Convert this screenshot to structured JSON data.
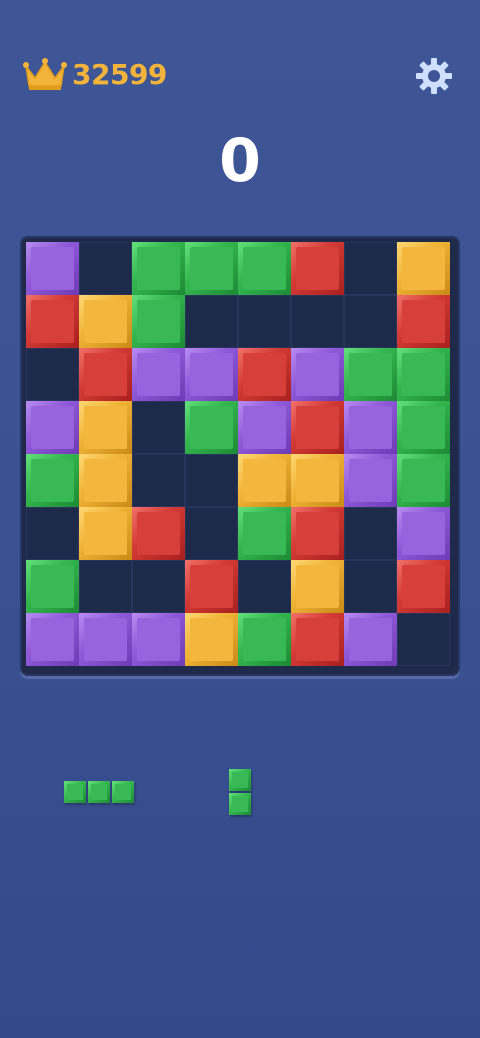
{
  "header": {
    "best_score": "32599",
    "current_score": "0"
  },
  "icons": {
    "best": "crown-icon",
    "settings": "gear-icon"
  },
  "colors": {
    "purple": "#9a63de",
    "green": "#39b955",
    "red": "#d7403a",
    "yellow": "#f2b73c",
    "empty": "#1e2a4a",
    "score_gold": "#f2b43a"
  },
  "board": {
    "size": 8,
    "rows": [
      [
        "purple",
        "empty",
        "green",
        "green",
        "green",
        "red",
        "empty",
        "yellow"
      ],
      [
        "red",
        "yellow",
        "green",
        "empty",
        "empty",
        "empty",
        "empty",
        "red"
      ],
      [
        "empty",
        "red",
        "purple",
        "purple",
        "red",
        "purple",
        "green",
        "green"
      ],
      [
        "purple",
        "yellow",
        "empty",
        "green",
        "purple",
        "red",
        "purple",
        "green"
      ],
      [
        "green",
        "yellow",
        "empty",
        "empty",
        "yellow",
        "yellow",
        "purple",
        "green"
      ],
      [
        "empty",
        "yellow",
        "red",
        "empty",
        "green",
        "red",
        "empty",
        "purple"
      ],
      [
        "green",
        "empty",
        "empty",
        "red",
        "empty",
        "yellow",
        "empty",
        "red"
      ],
      [
        "purple",
        "purple",
        "purple",
        "yellow",
        "green",
        "red",
        "purple",
        "empty"
      ]
    ]
  },
  "pieces": [
    {
      "name": "piece-horizontal-3",
      "color": "green",
      "cells": [
        [
          0,
          0
        ],
        [
          0,
          1
        ],
        [
          0,
          2
        ]
      ]
    },
    {
      "name": "piece-vertical-2",
      "color": "green",
      "cells": [
        [
          0,
          0
        ],
        [
          1,
          0
        ]
      ]
    }
  ]
}
